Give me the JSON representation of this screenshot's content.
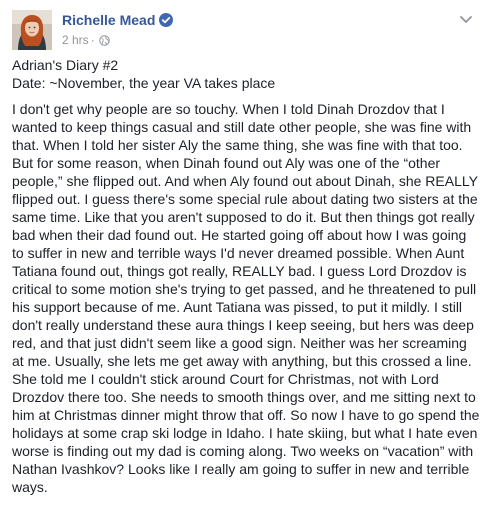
{
  "post": {
    "author": "Richelle Mead",
    "timestamp": "2 hrs",
    "separator": "·",
    "privacy_icon": "globe-icon",
    "verified_icon": "verified-badge-icon",
    "options_icon": "chevron-down-icon",
    "title": "Adrian's Diary #2",
    "date_line": "Date: ~November, the year VA takes place",
    "body": "I don't get why people are so touchy. When I told Dinah Drozdov that I wanted to keep things casual and still date other people, she was fine with that. When I told her sister Aly the same thing, she was fine with that too. But for some reason, when Dinah found out Aly was one of the “other people,” she flipped out. And when Aly found out about Dinah, she REALLY flipped out. I guess there's some special rule about dating two sisters at the same time. Like that you aren't supposed to do it. But then things got really bad when their dad found out. He started going off about how I was going to suffer in new and terrible ways I'd never dreamed possible. When Aunt Tatiana found out, things got really, REALLY bad. I guess Lord Drozdov is critical to some motion she's trying to get passed, and he threatened to pull his support because of me. Aunt Tatiana was pissed, to put it mildly. I still don't really understand these aura things I keep seeing, but hers was deep red, and that just didn't seem like a good sign. Neither was her screaming at me. Usually, she lets me get away with anything, but this crossed a line. She told me I couldn't stick around Court for Christmas, not with Lord Drozdov there too. She needs to smooth things over, and me sitting next to him at Christmas dinner might throw that off. So now I have to go spend the holidays at some crap ski lodge in Idaho. I hate skiing, but what I hate even worse is finding out my dad is coming along. Two weeks on “vacation” with Nathan Ivashkov? Looks like I really am going to suffer in new and terrible ways."
  },
  "colors": {
    "author_link": "#365899",
    "meta_text": "#90949c",
    "body_text": "#1d2129",
    "verified_blue": "#4267b2"
  }
}
